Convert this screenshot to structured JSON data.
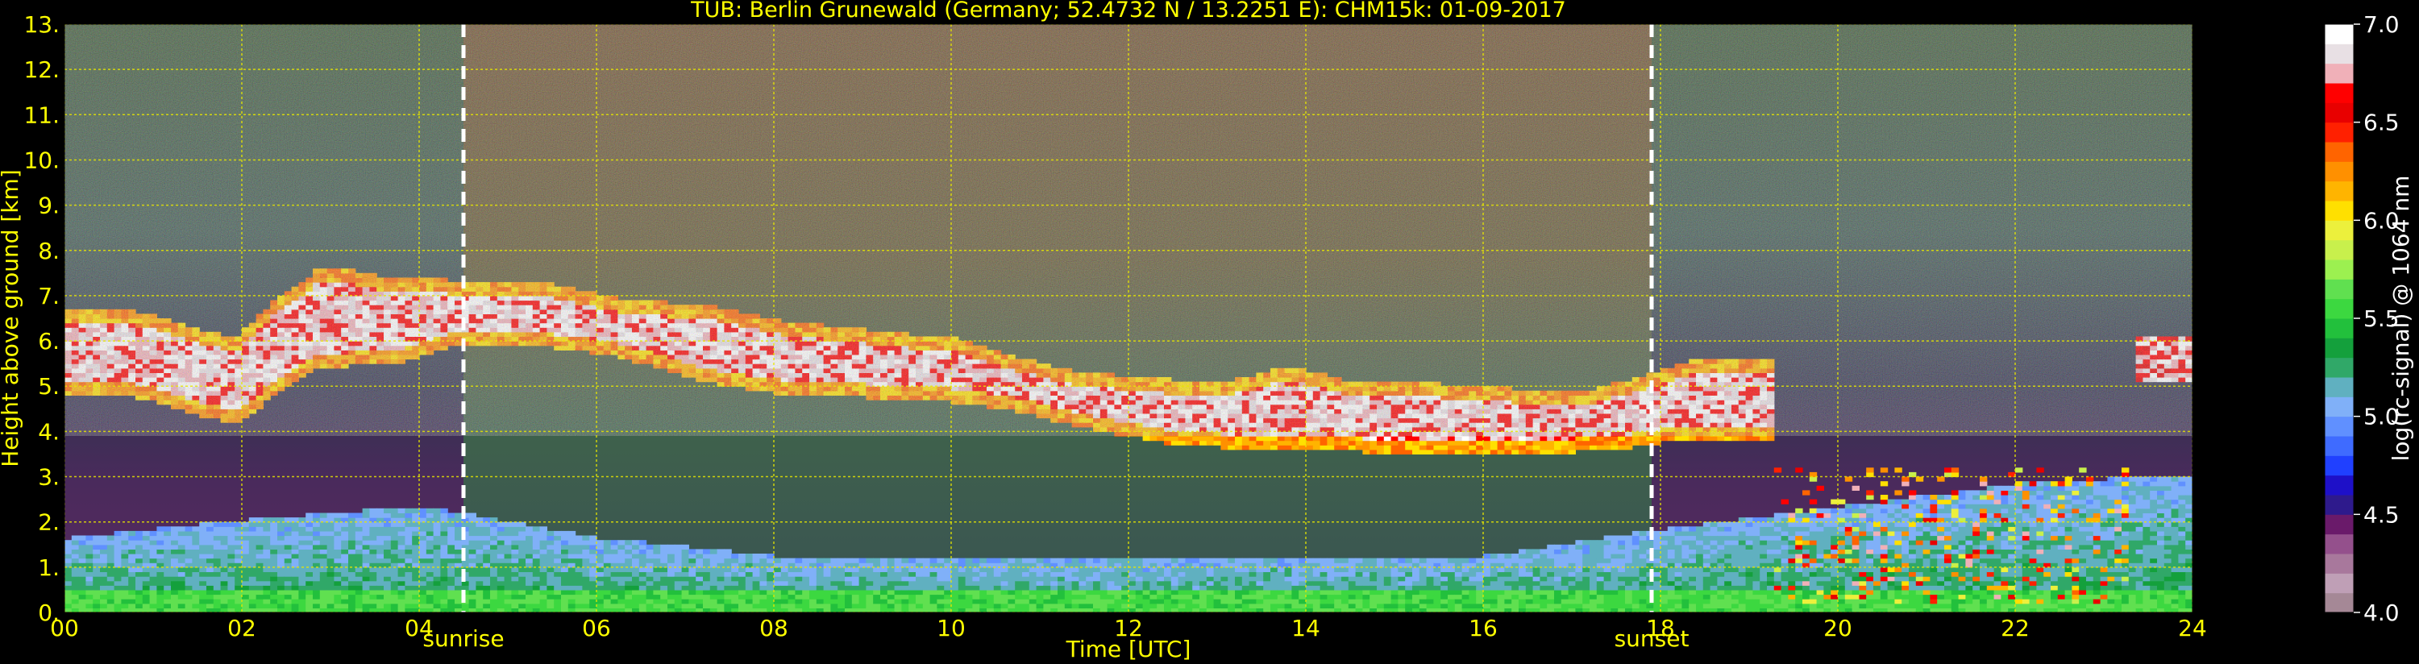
{
  "chart_data": {
    "type": "heatmap",
    "title": "TUB: Berlin Grunewald (Germany; 52.4732 N / 13.2251 E):    CHM15k: 01-09-2017",
    "xlabel": "Time [UTC]",
    "ylabel": "Height above ground [km]",
    "xlim": [
      0,
      24
    ],
    "ylim": [
      0,
      13
    ],
    "x_ticks": [
      0,
      2,
      4,
      6,
      8,
      10,
      12,
      14,
      16,
      18,
      20,
      22,
      24
    ],
    "x_tick_labels": [
      "00",
      "02",
      "04",
      "06",
      "08",
      "10",
      "12",
      "14",
      "16",
      "18",
      "20",
      "22",
      "24"
    ],
    "y_ticks": [
      0,
      1,
      2,
      3,
      4,
      5,
      6,
      7,
      8,
      9,
      10,
      11,
      12,
      13
    ],
    "y_tick_labels": [
      "0.",
      "1.",
      "2.",
      "3.",
      "4.",
      "5.",
      "6.",
      "7.",
      "8.",
      "9.",
      "10.",
      "11.",
      "12.",
      "13."
    ],
    "grid": true,
    "colorbar": {
      "label": "log(rc-signal) @ 1064 nm",
      "range": [
        4.0,
        7.0
      ],
      "ticks": [
        4.0,
        4.5,
        5.0,
        5.5,
        6.0,
        6.5,
        7.0
      ],
      "tick_labels": [
        "4.0",
        "4.5",
        "5.0",
        "5.5",
        "6.0",
        "6.5",
        "7.0"
      ],
      "colors": [
        "#a58896",
        "#bf9fb6",
        "#a8789c",
        "#94508c",
        "#6a1a6a",
        "#2e1a8c",
        "#1e10c8",
        "#2040ff",
        "#3f6bff",
        "#6090ff",
        "#80b0f8",
        "#60b0c0",
        "#30a868",
        "#14a03c",
        "#22c03c",
        "#3cd840",
        "#60e050",
        "#9cf050",
        "#c8f04c",
        "#ecf03c",
        "#ffe000",
        "#ffb400",
        "#ff9000",
        "#ff6400",
        "#ff2000",
        "#e80000",
        "#ff0000",
        "#f0b0b8",
        "#e8e0e4",
        "#ffffff"
      ]
    },
    "annotations": [
      {
        "x": 4.5,
        "label": "sunrise"
      },
      {
        "x": 17.9,
        "label": "sunset"
      }
    ],
    "cloud_layer_base_km": [
      [
        0.0,
        5.0
      ],
      [
        0.5,
        5.1
      ],
      [
        1.0,
        4.9
      ],
      [
        1.5,
        4.6
      ],
      [
        1.9,
        4.4
      ],
      [
        2.3,
        5.0
      ],
      [
        2.8,
        5.6
      ],
      [
        3.2,
        5.7
      ],
      [
        3.8,
        5.8
      ],
      [
        4.3,
        6.1
      ],
      [
        5.5,
        6.1
      ],
      [
        6.2,
        5.9
      ],
      [
        7.3,
        5.3
      ],
      [
        8.0,
        5.1
      ],
      [
        9.0,
        5.0
      ],
      [
        10.0,
        4.9
      ],
      [
        10.7,
        4.7
      ],
      [
        11.3,
        4.4
      ],
      [
        11.8,
        4.2
      ],
      [
        12.4,
        4.0
      ],
      [
        13.0,
        3.9
      ],
      [
        13.8,
        3.9
      ],
      [
        14.6,
        3.8
      ],
      [
        15.5,
        3.8
      ],
      [
        16.3,
        3.7
      ],
      [
        17.0,
        3.8
      ],
      [
        17.6,
        3.9
      ],
      [
        18.3,
        4.1
      ],
      [
        19.2,
        4.1
      ]
    ],
    "cloud_layer_top_km": [
      [
        0.0,
        6.3
      ],
      [
        0.5,
        6.4
      ],
      [
        1.0,
        6.2
      ],
      [
        1.5,
        5.9
      ],
      [
        1.9,
        5.7
      ],
      [
        2.3,
        6.5
      ],
      [
        2.8,
        7.2
      ],
      [
        3.2,
        7.2
      ],
      [
        3.8,
        7.0
      ],
      [
        4.3,
        7.0
      ],
      [
        5.5,
        6.9
      ],
      [
        6.2,
        6.6
      ],
      [
        7.3,
        6.4
      ],
      [
        8.0,
        6.1
      ],
      [
        9.0,
        5.9
      ],
      [
        10.0,
        5.7
      ],
      [
        10.7,
        5.3
      ],
      [
        11.3,
        5.0
      ],
      [
        11.8,
        4.9
      ],
      [
        12.4,
        4.8
      ],
      [
        13.0,
        4.7
      ],
      [
        13.8,
        5.1
      ],
      [
        14.6,
        4.7
      ],
      [
        15.5,
        4.7
      ],
      [
        16.3,
        4.6
      ],
      [
        17.0,
        4.5
      ],
      [
        17.6,
        4.8
      ],
      [
        18.3,
        5.2
      ],
      [
        19.2,
        5.3
      ]
    ],
    "late_cloud_km": {
      "x": [
        23.3,
        24.0
      ],
      "base": 5.0,
      "top": 6.0
    },
    "low_clouds_km": {
      "x": [
        19.2,
        23.2
      ],
      "base": 0.2,
      "top": 3.2
    },
    "boundary_layer_top_km": [
      [
        0,
        1.6
      ],
      [
        2,
        2.0
      ],
      [
        4,
        2.3
      ],
      [
        6,
        1.6
      ],
      [
        8,
        1.2
      ],
      [
        10,
        1.1
      ],
      [
        12,
        1.1
      ],
      [
        14,
        1.2
      ],
      [
        16,
        1.2
      ],
      [
        18,
        1.8
      ],
      [
        20,
        2.3
      ],
      [
        22,
        2.8
      ],
      [
        24,
        3.0
      ]
    ]
  }
}
